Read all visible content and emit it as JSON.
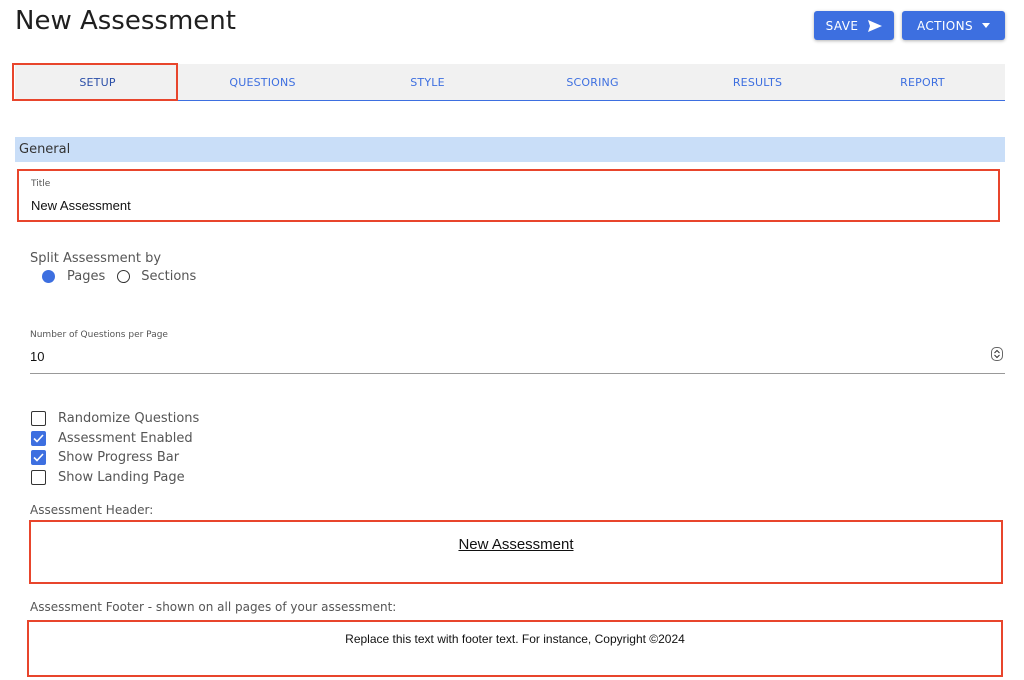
{
  "page": {
    "title": "New Assessment"
  },
  "header_buttons": {
    "save_label": "SAVE",
    "actions_label": "ACTIONS"
  },
  "tabs": [
    {
      "label": "SETUP",
      "active": true
    },
    {
      "label": "QUESTIONS",
      "active": false
    },
    {
      "label": "STYLE",
      "active": false
    },
    {
      "label": "SCORING",
      "active": false
    },
    {
      "label": "RESULTS",
      "active": false
    },
    {
      "label": "REPORT",
      "active": false
    }
  ],
  "general": {
    "section_label": "General",
    "title_label": "Title",
    "title_value": "New Assessment",
    "split_label": "Split Assessment by",
    "split_options": [
      {
        "label": "Pages",
        "selected": true
      },
      {
        "label": "Sections",
        "selected": false
      }
    ],
    "questions_per_page_label": "Number of Questions per Page",
    "questions_per_page_value": "10",
    "checkboxes": [
      {
        "label": "Randomize Questions",
        "checked": false
      },
      {
        "label": "Assessment Enabled",
        "checked": true
      },
      {
        "label": "Show Progress Bar",
        "checked": true
      },
      {
        "label": "Show Landing Page",
        "checked": false
      }
    ],
    "header_label": "Assessment Header:",
    "header_content": "New Assessment",
    "footer_label": "Assessment Footer - shown on all pages of your assessment:",
    "footer_content": "Replace this text with footer text. For instance, Copyright ©2024"
  },
  "colors": {
    "accent": "#3d6fe0",
    "section_bg": "#c9def8",
    "highlight": "#e8452c"
  },
  "icons": {
    "save": "send-icon",
    "actions": "caret-down-icon",
    "spinner": "stepper-icon",
    "checked": "checkmark-icon"
  }
}
